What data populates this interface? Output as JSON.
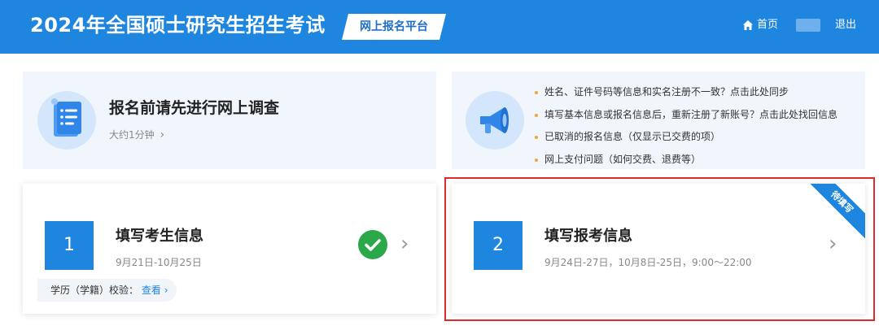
{
  "header": {
    "title": "2024年全国硕士研究生招生考试",
    "platform_badge": "网上报名平台",
    "home_label": "首页",
    "logout_label": "退出"
  },
  "survey": {
    "title": "报名前请先进行网上调查",
    "subtitle": "大约1分钟",
    "chevron": "›"
  },
  "help": {
    "items": [
      "姓名、证件号码等信息和实名注册不一致？点击此处同步",
      "填写基本信息或报名信息后，重新注册了新账号？点击此处找回信息",
      "已取消的报名信息（仅显示已交费的项）",
      "网上支付问题（如何交费、退费等）"
    ]
  },
  "steps": [
    {
      "number": "1",
      "title": "填写考生信息",
      "date": "9月21日-10月25日",
      "verify_label": "学历（学籍）校验：",
      "verify_link": "查看",
      "status": "completed"
    },
    {
      "number": "2",
      "title": "填写报考信息",
      "date": "9月24日-27日，10月8日-25日，9:00～22:00",
      "ribbon": "待填写"
    }
  ],
  "colors": {
    "brand_blue": "#1f86e0",
    "panel_bg": "#f1f6fd",
    "success_green": "#2ba84a",
    "highlight_red": "#e02b2b",
    "bullet_orange": "#f0a638"
  },
  "icons": {
    "home": "home-icon",
    "survey": "document-list-icon",
    "help": "megaphone-icon",
    "check": "check-circle-icon",
    "chevron": "chevron-right-icon"
  }
}
